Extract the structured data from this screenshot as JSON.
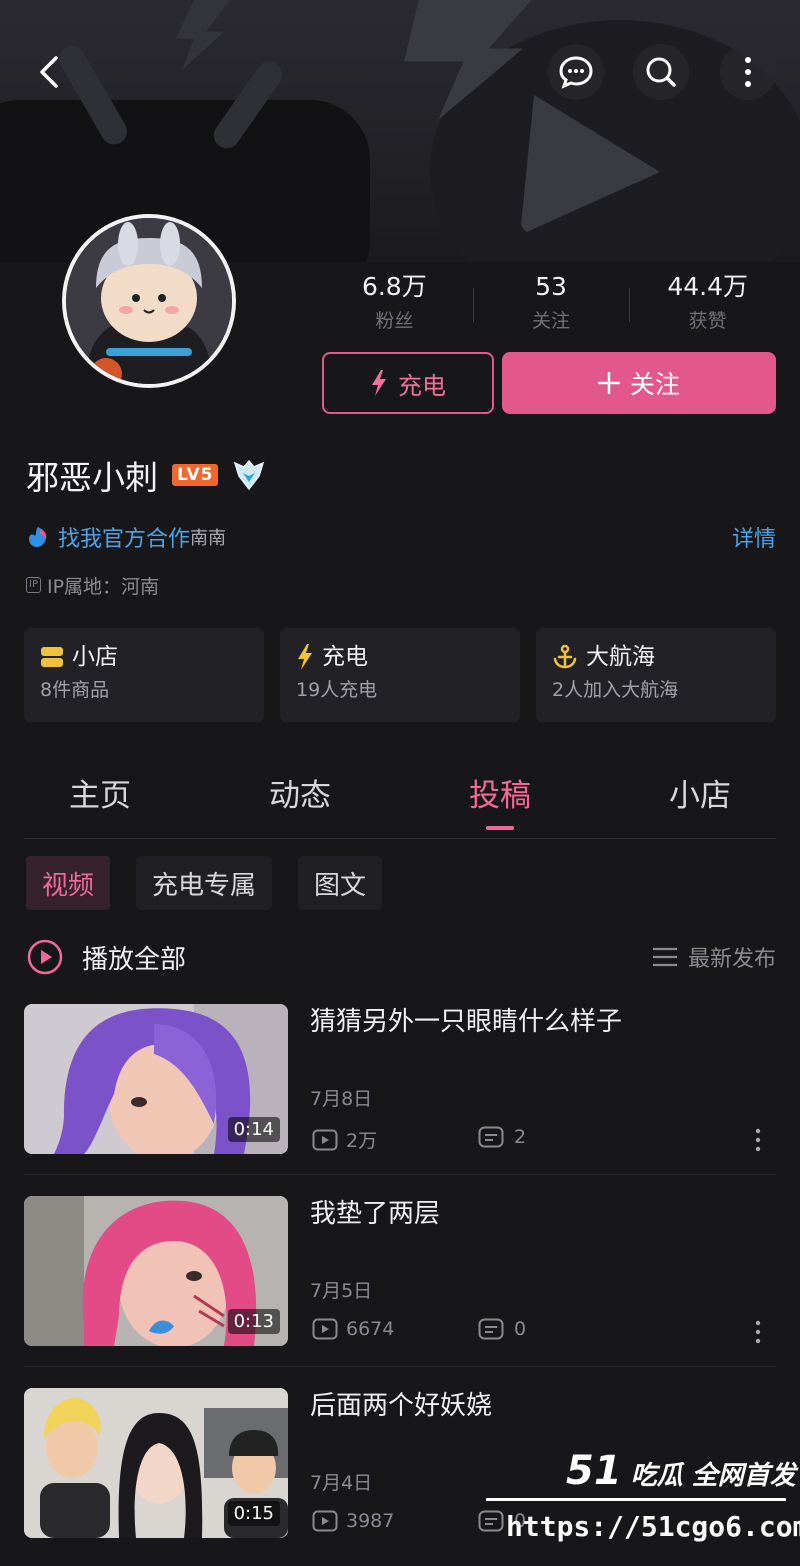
{
  "profile": {
    "stats": [
      {
        "value": "6.8万",
        "label": "粉丝"
      },
      {
        "value": "53",
        "label": "关注"
      },
      {
        "value": "44.4万",
        "label": "获赞"
      }
    ],
    "charge_label": "充电",
    "follow_label": "关注",
    "name": "邪恶小刺",
    "level_badge": "LV5",
    "coop_text": "找我官方合作",
    "coop_extra": "南南",
    "detail_label": "详情",
    "ip_icon": "IP",
    "ip_text": "IP属地：河南"
  },
  "cards": [
    {
      "title": "小店",
      "sub": "8件商品",
      "icon": "shop-icon"
    },
    {
      "title": "充电",
      "sub": "19人充电",
      "icon": "bolt-icon"
    },
    {
      "title": "大航海",
      "sub": "2人加入大航海",
      "icon": "anchor-icon"
    }
  ],
  "tabs": [
    "主页",
    "动态",
    "投稿",
    "小店"
  ],
  "active_tab": "投稿",
  "chips": [
    "视频",
    "充电专属",
    "图文"
  ],
  "list_header": {
    "play_all": "播放全部",
    "sort": "最新发布"
  },
  "videos": [
    {
      "title": "猜猜另外一只眼睛什么样子",
      "date": "7月8日",
      "plays": "2万",
      "comments": "2",
      "duration": "0:14"
    },
    {
      "title": "我垫了两层",
      "date": "7月5日",
      "plays": "6674",
      "comments": "0",
      "duration": "0:13"
    },
    {
      "title": "后面两个好妖娆",
      "date": "7月4日",
      "plays": "3987",
      "comments": "0",
      "duration": "0:15"
    }
  ],
  "watermark": {
    "brand_num": "51",
    "brand_text": "吃瓜 全网首发",
    "url": "https://51cgo6.com"
  },
  "colors": {
    "accent_pink": "#e2588a",
    "link_blue": "#4aa3e8",
    "level_orange": "#f2682c",
    "background": "#17171a"
  }
}
